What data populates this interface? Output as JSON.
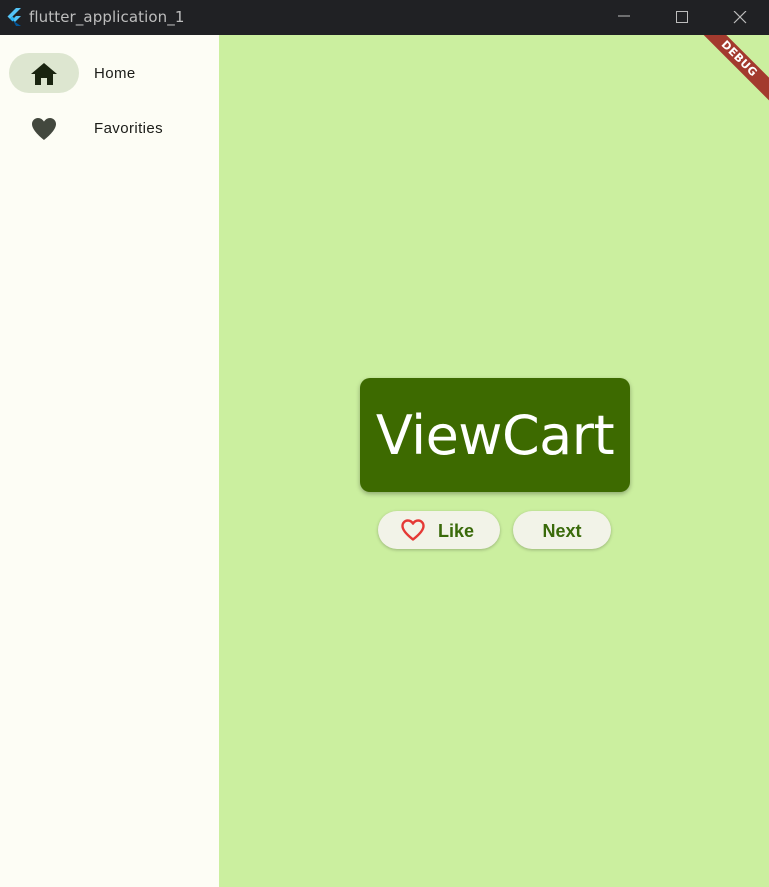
{
  "window": {
    "title": "flutter_application_1"
  },
  "sidebar": {
    "items": [
      {
        "label": "Home",
        "icon": "home-icon",
        "selected": true
      },
      {
        "label": "Favorities",
        "icon": "heart-icon",
        "selected": false
      }
    ]
  },
  "main": {
    "debug_banner": "DEBUG",
    "cart_label": "ViewCart",
    "like_label": "Like",
    "next_label": "Next"
  },
  "colors": {
    "titlebar": "#202124",
    "sidebar_bg": "#fdfdf5",
    "main_bg": "#cbef9f",
    "card_bg": "#3d6a00",
    "accent_text": "#3a6a0a",
    "heart_red": "#e53935",
    "debug_banner": "#a33a2e"
  }
}
